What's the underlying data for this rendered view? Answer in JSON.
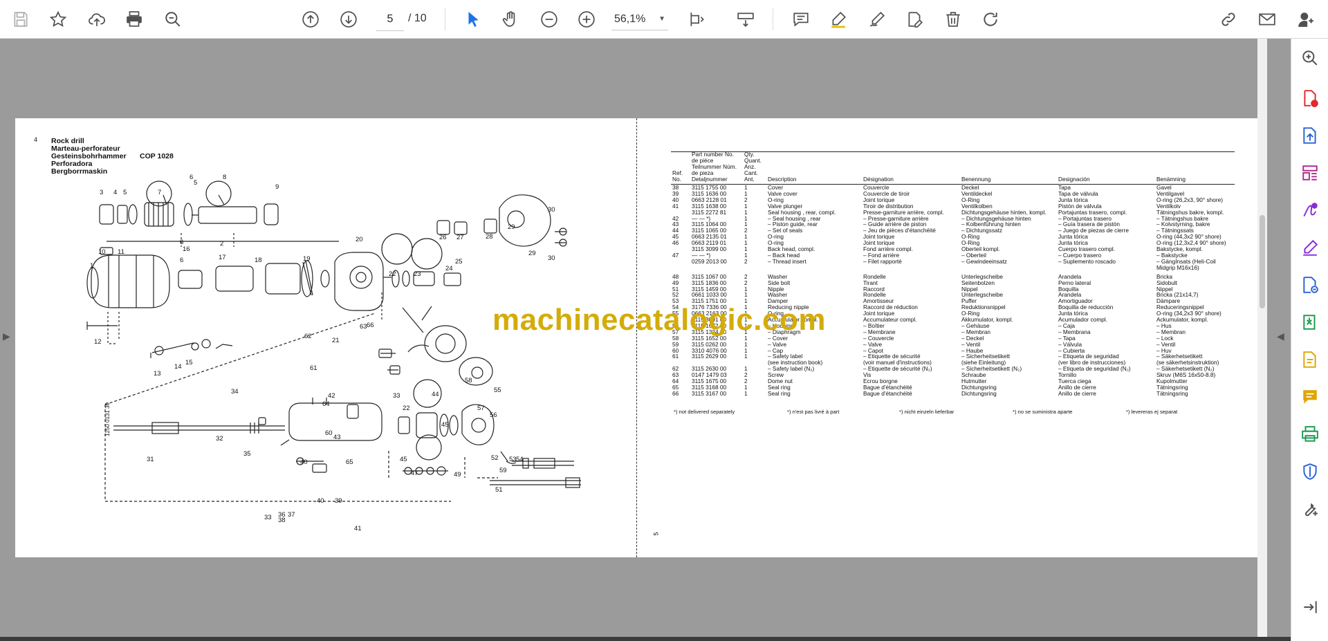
{
  "toolbar": {
    "current_page": "5",
    "page_total": "/ 10",
    "zoom": "56,1%",
    "icons": [
      "save-icon",
      "star-icon",
      "upload-icon",
      "print-icon",
      "zoom-search-icon",
      "page-up-icon",
      "page-down-icon",
      "select-cursor-icon",
      "hand-icon",
      "zoom-out-icon",
      "zoom-in-icon",
      "fit-page-icon",
      "scroll-mode-icon",
      "comment-icon",
      "highlight-icon",
      "draw-icon",
      "edit-text-icon",
      "delete-icon",
      "rotate-icon",
      "link-icon",
      "mail-icon",
      "account-icon"
    ]
  },
  "right_pane": {
    "icons": [
      "zoom-icon",
      "add-pdf-icon",
      "export-pdf-icon",
      "organize-pages-icon",
      "sign-icon",
      "fill-sign-icon",
      "send-icon",
      "compress-icon",
      "edit-pdf-icon",
      "comment-icon",
      "print-production-icon",
      "protect-icon",
      "tools-icon",
      "collapse-icon"
    ]
  },
  "colors": {
    "page_bg": "#ffffff",
    "canvas_bg": "#9b9b9b",
    "watermark": "#d4ac0a",
    "accent_blue": "#1a73e8"
  },
  "document": {
    "left_page_number": "4",
    "right_page_number": "5",
    "title_lines": [
      "Rock drill",
      "Marteau-perforateur",
      "Gesteinsbohrhammer",
      "Perforadora",
      "Bergborrmaskin"
    ],
    "model": "COP 1028",
    "drawing_code": "1250 0131 30",
    "diagram_labels": [
      "1",
      "2",
      "3",
      "4",
      "5",
      "5",
      "6",
      "6",
      "6",
      "7",
      "8",
      "9",
      "10",
      "11",
      "12",
      "13",
      "14",
      "15",
      "16",
      "17",
      "18",
      "19",
      "20",
      "21",
      "22",
      "23",
      "24",
      "25",
      "26",
      "27",
      "28",
      "29",
      "29",
      "30",
      "30",
      "31",
      "32",
      "33",
      "33",
      "34",
      "35",
      "36",
      "37",
      "38",
      "39",
      "40",
      "40",
      "41",
      "42",
      "43",
      "44",
      "45",
      "45",
      "47",
      "49",
      "51",
      "52",
      "53",
      "54",
      "55",
      "56",
      "57",
      "58",
      "59",
      "60",
      "61",
      "62",
      "63",
      "64",
      "65",
      "66",
      "22"
    ],
    "table_headers": {
      "ref": "Ref. No.",
      "part": "Part number No. de pièce Teilnummer Núm. de pieza Detaljnummer",
      "qty": "Qty. Quant. Anz. Cant. Ant.",
      "en": "Description",
      "fr": "Désignation",
      "de": "Benennung",
      "es": "Designación",
      "sv": "Benämning"
    },
    "rows": [
      [
        "38",
        "3115 1755 00",
        "1",
        "Cover",
        "Couvercle",
        "Deckel",
        "Tapa",
        "Gavel"
      ],
      [
        "39",
        "3115 1636 00",
        "1",
        "Valve cover",
        "Couvercle de tiroir",
        "Ventildeckel",
        "Tapa de válvula",
        "Ventilgavel"
      ],
      [
        "40",
        "0663 2128 01",
        "2",
        "O-ring",
        "Joint torique",
        "O-Ring",
        "Junta tórica",
        "O-ring (26,2x3, 90° shore)"
      ],
      [
        "41",
        "3115 1638 00",
        "1",
        "Valve plunger",
        "Tiroir de distribution",
        "Ventilkolben",
        "Pistón de válvula",
        "Ventilkolv"
      ],
      [
        "",
        "3115 2272 81",
        "1",
        "Seal housing , rear, compl.",
        "Presse-garniture arrière, compl.",
        "Dichtungsgehäuse hinten, kompl.",
        "Portajuntas trasero, compl.",
        "Tätningshus bakre, kompl."
      ],
      [
        "42",
        "— — *)",
        "1",
        "– Seal housing , rear",
        "– Presse-garniture arrière",
        "– Dichtungsgehäuse hinten",
        "– Portajuntas trasero",
        "– Tätningshus bakre"
      ],
      [
        "43",
        "3115 1064 00",
        "1",
        "– Piston guide, rear",
        "– Guide arrière de piston",
        "– Kolbenführung hinten",
        "– Guía trasera de pistón",
        "– Kolvstyrning, bakre"
      ],
      [
        "44",
        "3115 1065 00",
        "2",
        "– Set of seals",
        "– Jeu de pièces d'étanchéité",
        "– Dichtungssatz",
        "– Juego de piezas de cierre",
        "– Tätningssats"
      ],
      [
        "45",
        "0663 2135 01",
        "1",
        "O-ring",
        "Joint torique",
        "O-Ring",
        "Junta tórica",
        "O-ring (44,3x2 90° shore)"
      ],
      [
        "46",
        "0663 2119 01",
        "1",
        "O-ring",
        "Joint torique",
        "O-Ring",
        "Junta tórica",
        "O-ring (12,3x2,4 90° shore)"
      ],
      [
        "",
        "3115 3099 00",
        "1",
        "Back head, compl.",
        "Fond arrière compl.",
        "Oberteil kompl.",
        "Cuerpo trasero compl.",
        "Bakstycke, kompl."
      ],
      [
        "47",
        "— — *)",
        "1",
        "– Back head",
        "– Fond arrière",
        "– Oberteil",
        "– Cuerpo trasero",
        "– Bakstycke"
      ],
      [
        "",
        "0259 2013 00",
        "2",
        "– Thread insert",
        "– Filet rapporté",
        "– Gewindeeinsatz",
        "– Suplemento roscado",
        "– GängInsats (Heli-Coil"
      ],
      [
        "",
        "",
        "",
        "",
        "",
        "",
        "",
        "   Midgrip M16x16)"
      ],
      [
        "48",
        "3115 1067 00",
        "2",
        "Washer",
        "Rondelle",
        "Unterlegscheibe",
        "Arandela",
        "Bricka"
      ],
      [
        "49",
        "3115 1836 00",
        "2",
        "Side bolt",
        "Tirant",
        "Seitenbolzen",
        "Perno lateral",
        "Sidobult"
      ],
      [
        "51",
        "3115 1459 00",
        "1",
        "Nipple",
        "Raccord",
        "Nippel",
        "Boquilla",
        "Nippel"
      ],
      [
        "52",
        "0661 1033 00",
        "1",
        "Washer",
        "Rondelle",
        "Unterlegscheibe",
        "Arandela",
        "Bricka (21x14,7)"
      ],
      [
        "53",
        "3115 1751 00",
        "1",
        "Damper",
        "Amortisseur",
        "Puffer",
        "Amortiguador",
        "Dämpare"
      ],
      [
        "54",
        "3176 7336 00",
        "1",
        "Reducing nipple",
        "Raccord de réduction",
        "Reduktionsnippel",
        "Boquilla de reducción",
        "Reduceringsnippel"
      ],
      [
        "55",
        "0663 2163 00",
        "1",
        "O-ring",
        "Joint torique",
        "O-Ring",
        "Junta tórica",
        "O-ring (34,2x3 90° shore)"
      ],
      [
        "",
        "3115 3091 00",
        "1",
        "Accumulator compl.",
        "Accumulateur compl.",
        "Akkumulator, kompl.",
        "Acumulador compl.",
        "Ackumulator, kompl."
      ],
      [
        "56",
        "3115 1672 00",
        "1",
        "– Housing",
        "– Boîtier",
        "– Gehäuse",
        "– Caja",
        "– Hus"
      ],
      [
        "57",
        "3115 1324 00",
        "1",
        "– Diaphragm",
        "– Membrane",
        "– Membran",
        "– Membrana",
        "– Membran"
      ],
      [
        "58",
        "3115 1652 00",
        "1",
        "– Cover",
        "– Couvercle",
        "– Deckel",
        "– Tapa",
        "– Lock"
      ],
      [
        "59",
        "3115 0262 00",
        "1",
        "– Valve",
        "– Valve",
        "– Ventil",
        "– Válvula",
        "– Ventil"
      ],
      [
        "60",
        "3310 4076 00",
        "1",
        "– Cap",
        "– Capot",
        "– Haube",
        "– Cubierta",
        "– Huv"
      ],
      [
        "61",
        "3115 2629 00",
        "1",
        "– Safety label",
        "– Etiquette de sécurité",
        "– Sicherheitsetikett",
        "– Etiqueta de seguridad",
        "– Säkerhetsetikett"
      ],
      [
        "",
        "",
        "",
        "  (see instruction book)",
        "  (voir manuel d'instructions)",
        "  (siehe Einleitung)",
        "  (ver libro de instrucciones)",
        "  (se säkerhetsinstruktion)"
      ],
      [
        "62",
        "3115 2630 00",
        "1",
        "– Safety label (N₂)",
        "– Etiquette de sécurité (N₂)",
        "– Sicherheitsetikett (N₂)",
        "– Etiqueta de seguridad (N₂)",
        "– Säkerhetsetikett (N₂)"
      ],
      [
        "63",
        "0147 1479 03",
        "2",
        "Screw",
        "Vis",
        "Schraube",
        "Tornillo",
        "Skruv (M6S 16x50-8.8)"
      ],
      [
        "64",
        "3115 1675 00",
        "2",
        "Dome nut",
        "Ecrou borgne",
        "Hutmutter",
        "Tuerca ciega",
        "Kupolmutter"
      ],
      [
        "65",
        "3115 3168 00",
        "1",
        "Seal ring",
        "Bague d'étanchéité",
        "Dichtungsring",
        "Anillo de cierre",
        "Tätningsring"
      ],
      [
        "66",
        "3115 3167 00",
        "1",
        "Seal ring",
        "Bague d'étanchéité",
        "Dichtungsring",
        "Anillo de cierre",
        "Tätningsring"
      ]
    ],
    "footnotes": [
      "*) not delivered separately",
      "*) n'est pas livré à part",
      "*) nicht einzeln lieferbar",
      "*) no se suministra aparte",
      "*) levereras ej separat"
    ]
  },
  "watermark": "machinecatalogic.com"
}
